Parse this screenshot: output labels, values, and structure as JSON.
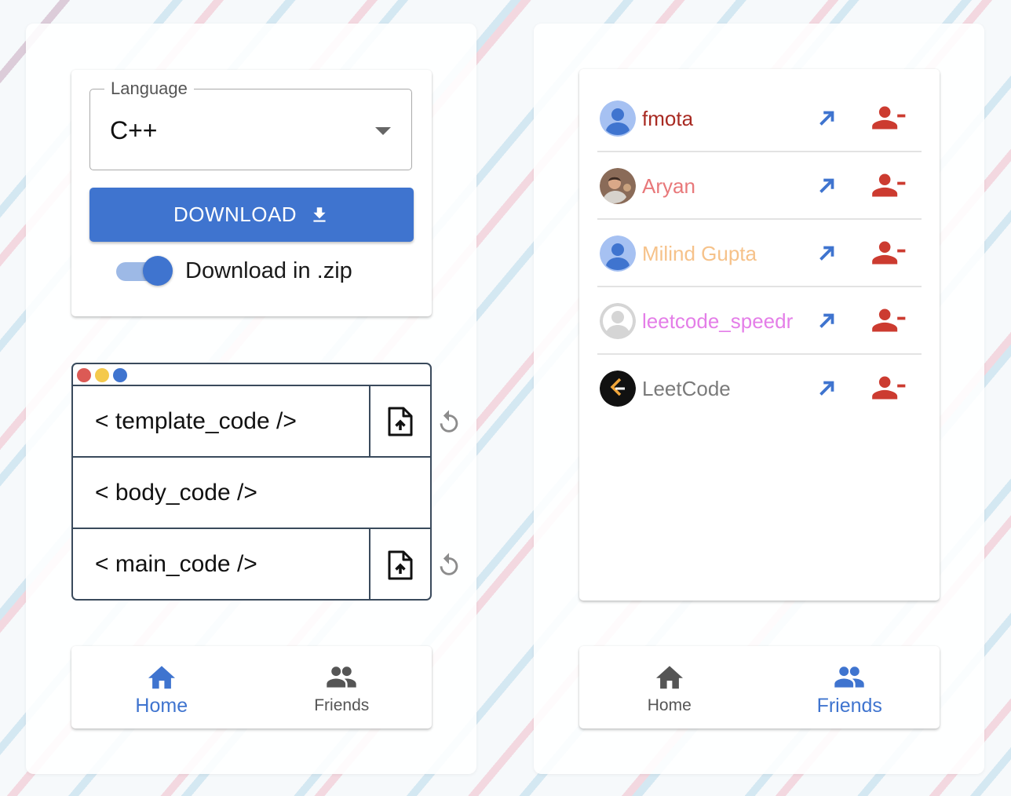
{
  "colors": {
    "accent": "#3f74cf",
    "remove": "#cc3b30",
    "window_border": "#3a4a5c",
    "dot_red": "#dc5a55",
    "dot_yellow": "#f4c94c",
    "dot_blue": "#3f74cf"
  },
  "home_panel": {
    "language_select": {
      "legend": "Language",
      "value": "C++",
      "icon": "chevron-down-icon"
    },
    "download_button": {
      "label": "DOWNLOAD",
      "icon": "download-icon"
    },
    "zip_toggle": {
      "label": "Download in .zip",
      "on": true
    },
    "code_window": {
      "rows": [
        {
          "label": "< template_code />",
          "upload": true,
          "reset": true
        },
        {
          "label": "< body_code />",
          "upload": false,
          "reset": false
        },
        {
          "label": "< main_code />",
          "upload": true,
          "reset": true
        }
      ]
    },
    "nav": {
      "home": {
        "label": "Home",
        "icon": "home-icon",
        "active": true
      },
      "friends": {
        "label": "Friends",
        "icon": "people-icon",
        "active": false
      }
    }
  },
  "friends_panel": {
    "friends": [
      {
        "name": "fmota",
        "color": "#a82a22",
        "avatar": "default-avatar"
      },
      {
        "name": "Aryan",
        "color": "#e8787a",
        "avatar": "photo-avatar"
      },
      {
        "name": "Milind Gupta",
        "color": "#f6c28a",
        "avatar": "default-avatar"
      },
      {
        "name": "leetcode_speedr",
        "color": "#e47ee8",
        "avatar": "grey-avatar"
      },
      {
        "name": "LeetCode",
        "color": "#7a7a7a",
        "avatar": "leetcode-logo"
      }
    ],
    "nav": {
      "home": {
        "label": "Home",
        "icon": "home-icon",
        "active": false
      },
      "friends": {
        "label": "Friends",
        "icon": "people-icon",
        "active": true
      }
    }
  }
}
